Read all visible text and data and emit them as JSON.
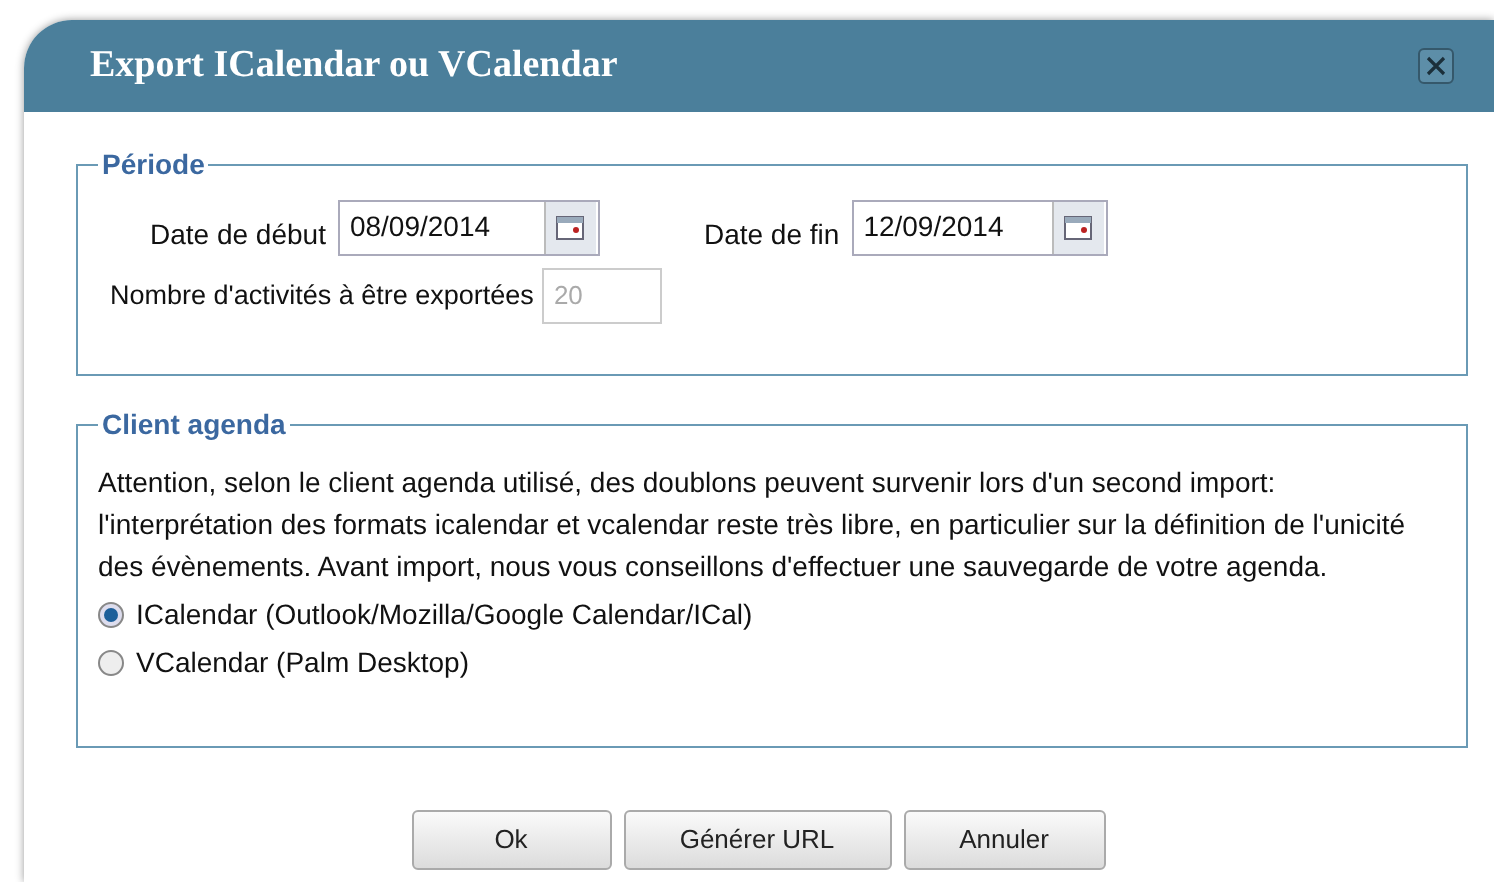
{
  "window": {
    "title": "Export ICalendar ou VCalendar"
  },
  "periode": {
    "legend": "Période",
    "start": {
      "label": "Date de début",
      "value": "08/09/2014"
    },
    "end": {
      "label": "Date de fin",
      "value": "12/09/2014"
    },
    "count": {
      "label": "Nombre d'activités à être exportées",
      "value": "20",
      "disabled": true
    }
  },
  "client": {
    "legend": "Client agenda",
    "notice": "Attention, selon le client agenda utilisé, des doublons peuvent survenir lors d'un second import: l'interprétation des formats icalendar et vcalendar reste très libre, en particulier sur la définition de l'unicité des évènements. Avant import, nous vous conseillons d'effectuer une sauvegarde de votre agenda.",
    "options": [
      {
        "label": "ICalendar (Outlook/Mozilla/Google Calendar/ICal)",
        "selected": true
      },
      {
        "label": "VCalendar (Palm Desktop)",
        "selected": false
      }
    ]
  },
  "buttons": [
    "Ok",
    "Générer URL",
    "Annuler"
  ]
}
